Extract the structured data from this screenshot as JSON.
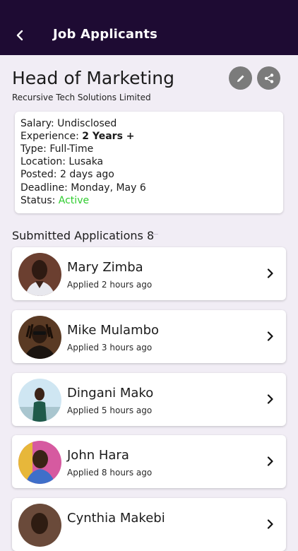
{
  "appbar": {
    "title": "Job Applicants",
    "back_icon": "arrow-back-icon"
  },
  "job": {
    "title": "Head of Marketing",
    "company": "Recursive Tech Solutions Limited",
    "edit_icon": "pencil-icon",
    "share_icon": "share-icon"
  },
  "details": {
    "salary_label": "Salary:",
    "salary_value": "Undisclosed",
    "experience_label": "Experience:",
    "experience_value": "2 Years +",
    "type_label": "Type:",
    "type_value": "Full-Time",
    "location_label": "Location:",
    "location_value": "Lusaka",
    "posted_label": "Posted:",
    "posted_value": "2 days ago",
    "deadline_label": "Deadline:",
    "deadline_value": "Monday, May 6",
    "status_label": "Status:",
    "status_value": "Active"
  },
  "applications": {
    "title": "Submitted Applications",
    "count": "8",
    "items": [
      {
        "name": "Mary Zimba",
        "time": "Applied 2 hours ago"
      },
      {
        "name": "Mike Mulambo",
        "time": "Applied 3 hours ago"
      },
      {
        "name": "Dingani Mako",
        "time": "Applied 5 hours ago"
      },
      {
        "name": "John Hara",
        "time": "Applied 8 hours ago"
      },
      {
        "name": "Cynthia Makebi",
        "time": ""
      }
    ]
  },
  "colors": {
    "appbar": "#1e0b33",
    "background": "#f1edf5",
    "status_active": "#2ecc2e",
    "icon_button": "#7b7b7b"
  }
}
